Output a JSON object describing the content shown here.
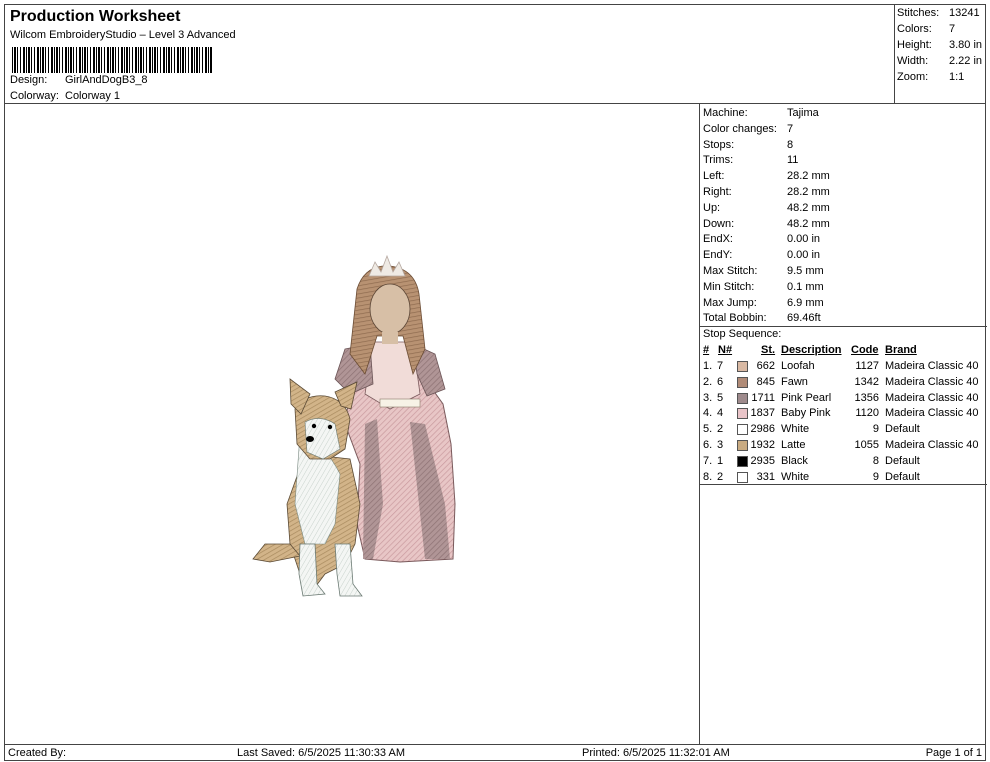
{
  "header": {
    "title": "Production Worksheet",
    "subtitle": "Wilcom EmbroideryStudio – Level 3 Advanced",
    "design_label": "Design:",
    "design_value": "GirlAndDogB3_8",
    "colorway_label": "Colorway:",
    "colorway_value": "Colorway 1"
  },
  "stats": [
    {
      "label": "Stitches:",
      "value": "13241"
    },
    {
      "label": "Colors:",
      "value": "7"
    },
    {
      "label": "Height:",
      "value": "3.80 in"
    },
    {
      "label": "Width:",
      "value": "2.22 in"
    },
    {
      "label": "Zoom:",
      "value": "1:1"
    }
  ],
  "machine_info": [
    {
      "label": "Machine:",
      "value": "Tajima"
    },
    {
      "label": "Color changes:",
      "value": "7"
    },
    {
      "label": "Stops:",
      "value": "8"
    },
    {
      "label": "Trims:",
      "value": "11"
    },
    {
      "label": "Left:",
      "value": "28.2 mm"
    },
    {
      "label": "Right:",
      "value": "28.2 mm"
    },
    {
      "label": "Up:",
      "value": "48.2 mm"
    },
    {
      "label": "Down:",
      "value": "48.2 mm"
    },
    {
      "label": "EndX:",
      "value": "0.00 in"
    },
    {
      "label": "EndY:",
      "value": "0.00 in"
    },
    {
      "label": "Max Stitch:",
      "value": "9.5 mm"
    },
    {
      "label": "Min Stitch:",
      "value": "0.1 mm"
    },
    {
      "label": "Max Jump:",
      "value": "6.9 mm"
    },
    {
      "label": "Total Bobbin:",
      "value": "69.46ft"
    }
  ],
  "stop_sequence": {
    "title": "Stop Sequence:",
    "headers": {
      "num": "#",
      "n": "N#",
      "st": "St.",
      "desc": "Description",
      "code": "Code",
      "brand": "Brand"
    },
    "rows": [
      {
        "num": "1.",
        "n": "7",
        "color": "#d9b9a3",
        "st": "662",
        "desc": "Loofah",
        "code": "1127",
        "brand": "Madeira Classic 40"
      },
      {
        "num": "2.",
        "n": "6",
        "color": "#b08b77",
        "st": "845",
        "desc": "Fawn",
        "code": "1342",
        "brand": "Madeira Classic 40"
      },
      {
        "num": "3.",
        "n": "5",
        "color": "#9e8a8c",
        "st": "1711",
        "desc": "Pink Pearl",
        "code": "1356",
        "brand": "Madeira Classic 40"
      },
      {
        "num": "4.",
        "n": "4",
        "color": "#e9c4c8",
        "st": "1837",
        "desc": "Baby Pink",
        "code": "1120",
        "brand": "Madeira Classic 40"
      },
      {
        "num": "5.",
        "n": "2",
        "color": "#ffffff",
        "st": "2986",
        "desc": "White",
        "code": "9",
        "brand": "Default"
      },
      {
        "num": "6.",
        "n": "3",
        "color": "#c9ab82",
        "st": "1932",
        "desc": "Latte",
        "code": "1055",
        "brand": "Madeira Classic 40"
      },
      {
        "num": "7.",
        "n": "1",
        "color": "#000000",
        "st": "2935",
        "desc": "Black",
        "code": "8",
        "brand": "Default"
      },
      {
        "num": "8.",
        "n": "2",
        "color": "#ffffff",
        "st": "331",
        "desc": "White",
        "code": "9",
        "brand": "Default"
      }
    ]
  },
  "footer": {
    "created_by": "Created By:",
    "last_saved": "Last Saved: 6/5/2025 11:30:33 AM",
    "printed": "Printed: 6/5/2025 11:32:01 AM",
    "page": "Page 1 of 1"
  }
}
